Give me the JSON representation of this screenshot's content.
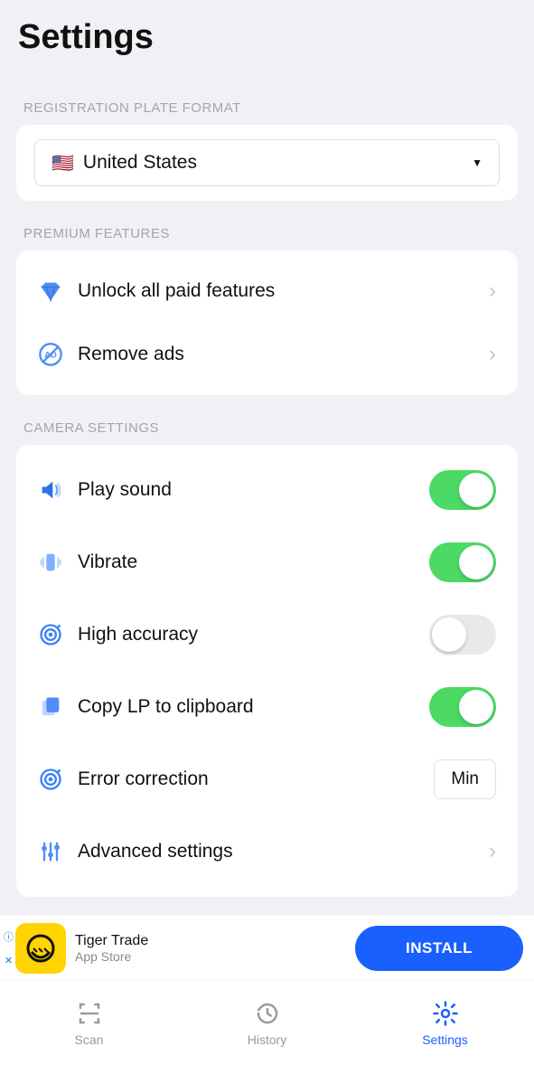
{
  "header": {
    "title": "Settings"
  },
  "sections": {
    "plate": {
      "label": "REGISTRATION PLATE FORMAT",
      "selected_flag": "🇺🇸",
      "selected_value": "United States"
    },
    "premium": {
      "label": "PREMIUM FEATURES",
      "items": {
        "unlock": "Unlock all paid features",
        "remove_ads": "Remove ads"
      }
    },
    "camera": {
      "label": "CAMERA SETTINGS",
      "items": {
        "play_sound": {
          "label": "Play sound",
          "value": true
        },
        "vibrate": {
          "label": "Vibrate",
          "value": true
        },
        "high_accuracy": {
          "label": "High accuracy",
          "value": false
        },
        "copy_clipboard": {
          "label": "Copy LP to clipboard",
          "value": true
        },
        "error_correction": {
          "label": "Error correction",
          "value": "Min"
        },
        "advanced": {
          "label": "Advanced settings"
        }
      }
    }
  },
  "ad": {
    "app_name": "Tiger Trade",
    "app_source": "App Store",
    "cta": "INSTALL"
  },
  "tabs": {
    "scan": "Scan",
    "history": "History",
    "settings": "Settings"
  }
}
